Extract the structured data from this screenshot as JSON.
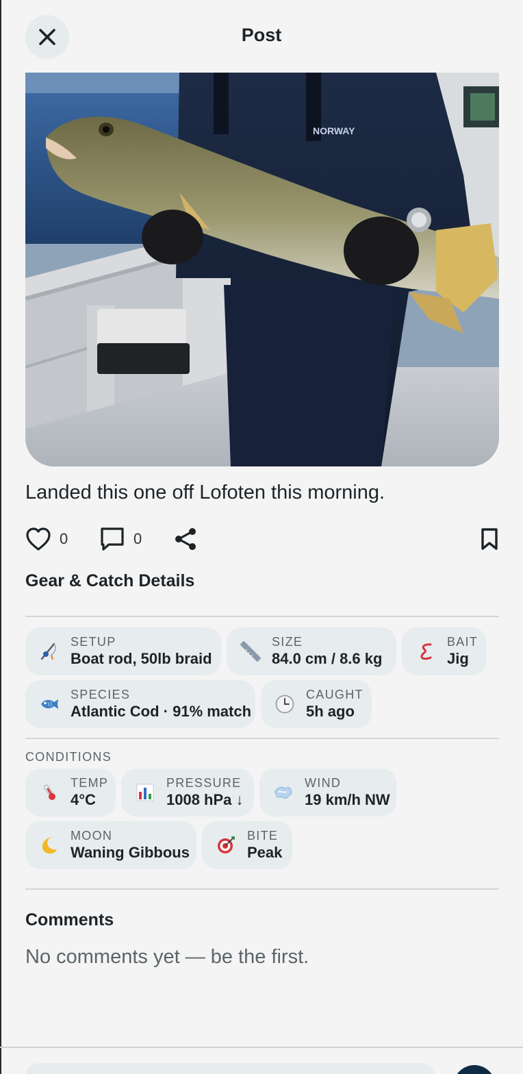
{
  "header": {
    "title": "Post"
  },
  "post": {
    "caption": "Landed this one off Lofoten this morning.",
    "likes": "0",
    "comments_count": "0"
  },
  "gear": {
    "title": "Gear & Catch Details",
    "chips": [
      {
        "label": "SETUP",
        "value": "Boat rod, 50lb braid",
        "icon": "fishing-rod-icon"
      },
      {
        "label": "SIZE",
        "value": "84.0 cm / 8.6 kg",
        "icon": "ruler-icon"
      },
      {
        "label": "BAIT",
        "value": "Jig",
        "icon": "worm-icon"
      },
      {
        "label": "SPECIES",
        "value": "Atlantic Cod · 91% match",
        "icon": "fish-icon"
      },
      {
        "label": "CAUGHT",
        "value": "5h ago",
        "icon": "clock-icon"
      }
    ]
  },
  "conditions": {
    "title": "CONDITIONS",
    "chips": [
      {
        "label": "TEMP",
        "value": "4°C",
        "icon": "thermometer-icon"
      },
      {
        "label": "PRESSURE",
        "value": "1008 hPa ↓",
        "icon": "bar-chart-icon"
      },
      {
        "label": "WIND",
        "value": "19 km/h NW",
        "icon": "wind-icon"
      },
      {
        "label": "MOON",
        "value": "Waning Gibbous",
        "icon": "moon-icon"
      },
      {
        "label": "BITE",
        "value": "Peak",
        "icon": "target-icon"
      }
    ]
  },
  "comments": {
    "title": "Comments",
    "empty": "No comments yet — be the first."
  }
}
